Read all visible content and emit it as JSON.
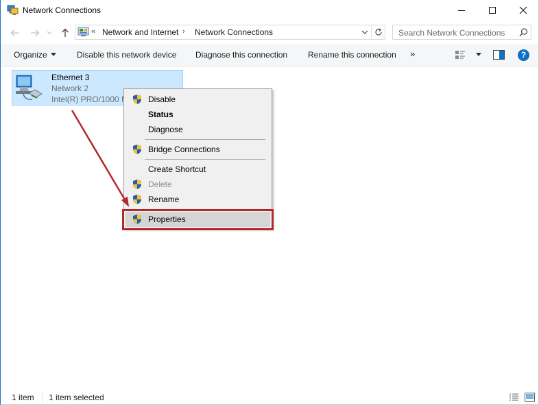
{
  "window": {
    "title": "Network Connections",
    "controls": {
      "minimize_icon": "minimize-icon",
      "maximize_icon": "maximize-icon",
      "close_icon": "close-icon"
    }
  },
  "address": {
    "overflow": "«",
    "breadcrumbs": [
      "Network and Internet",
      "Network Connections"
    ],
    "separator": "›",
    "search_placeholder": "Search Network Connections"
  },
  "commands": {
    "organize": "Organize",
    "disable": "Disable this network device",
    "diagnose": "Diagnose this connection",
    "rename": "Rename this connection",
    "more": "»",
    "help": "?"
  },
  "connection": {
    "name": "Ethernet 3",
    "network": "Network  2",
    "adapter": "Intel(R) PRO/1000 M"
  },
  "context_menu": {
    "items": [
      {
        "label": "Disable",
        "shield": true,
        "bold": false,
        "disabled": false
      },
      {
        "label": "Status",
        "shield": false,
        "bold": true,
        "disabled": false
      },
      {
        "label": "Diagnose",
        "shield": false,
        "bold": false,
        "disabled": false
      },
      {
        "label": "Bridge Connections",
        "shield": true,
        "bold": false,
        "disabled": false
      },
      {
        "label": "Create Shortcut",
        "shield": false,
        "bold": false,
        "disabled": false
      },
      {
        "label": "Delete",
        "shield": true,
        "bold": false,
        "disabled": true
      },
      {
        "label": "Rename",
        "shield": true,
        "bold": false,
        "disabled": false
      },
      {
        "label": "Properties",
        "shield": true,
        "bold": false,
        "disabled": false,
        "highlighted": true
      }
    ]
  },
  "status": {
    "count": "1 item",
    "selected": "1 item selected"
  },
  "colors": {
    "accent": "#1070c8",
    "selection": "#cce8ff",
    "annotation": "#b2282c"
  }
}
